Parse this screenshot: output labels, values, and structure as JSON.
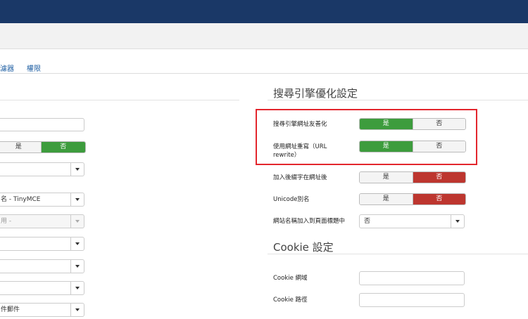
{
  "tabs": {
    "filter": "濾器",
    "permissions": "權限"
  },
  "left_column": {
    "yes_no_toggle": {
      "yes": "是",
      "no": "否",
      "selected": "no"
    },
    "editor_select": "名 - TinyMCE",
    "disabled_select": "用 -",
    "mail_select": "件郵件"
  },
  "seo": {
    "title": "搜尋引擎優化設定",
    "friendly_urls": {
      "label": "搜尋引擎網址友善化",
      "yes": "是",
      "no": "否",
      "selected": "yes"
    },
    "url_rewrite": {
      "label": "使用網址重寫（URL rewrite）",
      "yes": "是",
      "no": "否",
      "selected": "yes"
    },
    "suffix": {
      "label": "加入後綴字在網址後",
      "yes": "是",
      "no": "否",
      "selected": "no"
    },
    "unicode_aliases": {
      "label": "Unicode別名",
      "yes": "是",
      "no": "否",
      "selected": "no"
    },
    "site_name_in_title": {
      "label": "網站名稱加入到頁面標題中",
      "value": "否"
    }
  },
  "cookie": {
    "title": "Cookie 設定",
    "domain": {
      "label": "Cookie 網域",
      "value": ""
    },
    "path": {
      "label": "Cookie 路徑",
      "value": ""
    }
  },
  "colors": {
    "header": "#1a3867",
    "yes_on": "#3d9c3d",
    "no_on": "#bd362f",
    "highlight": "#e3262d",
    "link": "#1f5fa3"
  }
}
